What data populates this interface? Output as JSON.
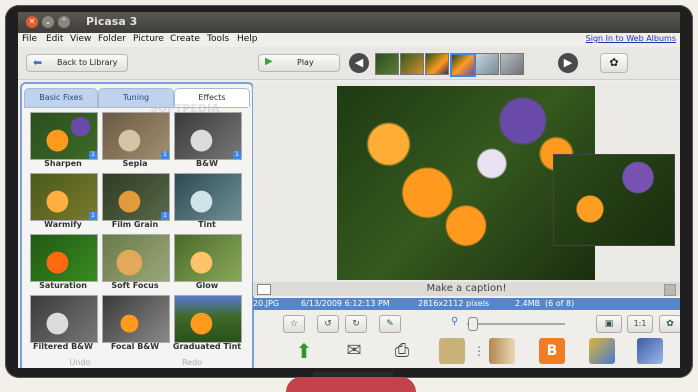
{
  "window": {
    "title": "Picasa 3"
  },
  "menu": [
    "File",
    "Edit",
    "View",
    "Folder",
    "Picture",
    "Create",
    "Tools",
    "Help"
  ],
  "signin_link": "Sign In to Web Albums",
  "toolbar": {
    "back_label": "Back to Library",
    "play_label": "Play"
  },
  "left_panel": {
    "tabs": [
      {
        "label": "Basic Fixes",
        "active": false
      },
      {
        "label": "Tuning",
        "active": false
      },
      {
        "label": "Effects",
        "active": true
      }
    ],
    "watermark": "SOFTPEDIA",
    "effects": [
      {
        "label": "Sharpen",
        "badge": "1",
        "tone": "color"
      },
      {
        "label": "Sepia",
        "badge": "1",
        "tone": "sepia"
      },
      {
        "label": "B&W",
        "badge": "1",
        "tone": "bw"
      },
      {
        "label": "Warmify",
        "badge": "1",
        "tone": "warm"
      },
      {
        "label": "Film Grain",
        "badge": "1",
        "tone": "grain"
      },
      {
        "label": "Tint",
        "badge": "",
        "tone": "tint"
      },
      {
        "label": "Saturation",
        "badge": "",
        "tone": "sat"
      },
      {
        "label": "Soft Focus",
        "badge": "",
        "tone": "soft"
      },
      {
        "label": "Glow",
        "badge": "",
        "tone": "glow"
      },
      {
        "label": "Filtered B&W",
        "badge": "",
        "tone": "bw"
      },
      {
        "label": "Focal B&W",
        "badge": "",
        "tone": "focal"
      },
      {
        "label": "Graduated Tint",
        "badge": "",
        "tone": "grad"
      }
    ],
    "undo_label": "Undo",
    "redo_label": "Redo"
  },
  "photo": {
    "caption_placeholder": "Make a caption!",
    "info": {
      "filename": "20.JPG",
      "date": "6/13/2009 6:12:13 PM",
      "dimensions": "2816x2112 pixels",
      "size": "2.4MB",
      "position": "(6 of 8)"
    }
  },
  "colors": {
    "accent": "#7aa1d6",
    "info_bar": "#5686c8",
    "title_bar": "#4a4843"
  }
}
